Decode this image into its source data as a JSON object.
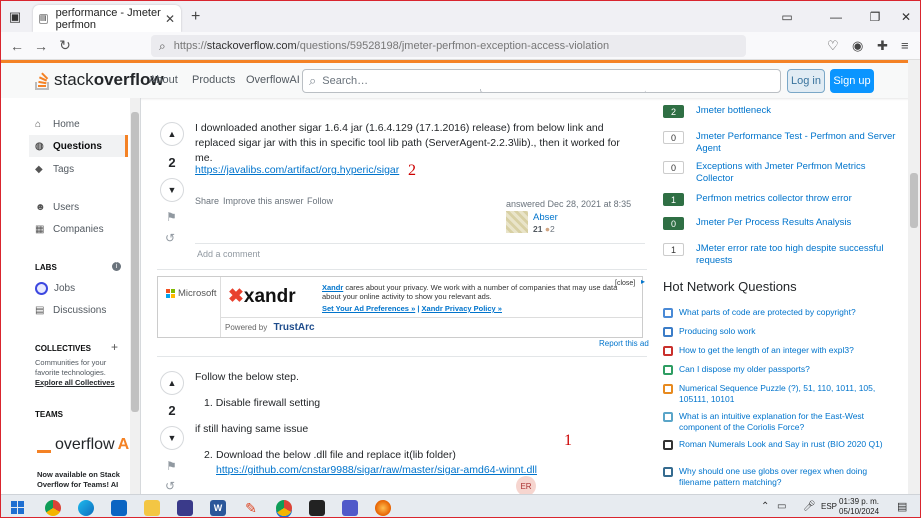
{
  "browser": {
    "tab_title": "performance - Jmeter perfmon",
    "url_prefix": "https://",
    "url_host": "stackoverflow.com",
    "url_path": "/questions/59528198/jmeter-perfmon-exception-access-violation"
  },
  "header": {
    "logo_text_light": "stack",
    "logo_text_bold": "overflow",
    "links": [
      "About",
      "Products",
      "OverflowAI"
    ],
    "search_placeholder": "Search…",
    "login_label": "Log in",
    "signup_label": "Sign up"
  },
  "leftnav": {
    "items": [
      {
        "label": "Home",
        "icon": "home-icon"
      },
      {
        "label": "Questions",
        "icon": "globe-icon"
      },
      {
        "label": "Tags",
        "icon": "tag-icon"
      },
      {
        "label": "Users",
        "icon": "users-icon"
      },
      {
        "label": "Companies",
        "icon": "building-icon"
      }
    ],
    "labs_heading": "LABS",
    "labs_items": [
      "Jobs",
      "Discussions"
    ],
    "collectives_heading": "COLLECTIVES",
    "collectives_text": "Communities for your favorite technologies.",
    "collectives_link": "Explore all Collectives",
    "teams_heading": "TEAMS",
    "teams_logo_text": "overflow",
    "teams_logo_ai": "AI",
    "teams_text": "Now available on Stack Overflow for Teams! AI"
  },
  "answer1": {
    "score": "2",
    "text": "I downloaded another sigar 1.6.4 jar (1.6.4.129 (17.1.2016) release) from below link and replaced sigar jar with this in specific tool lib path (ServerAgent-2.2.3\\lib)., then it worked for me.",
    "link": "https://javalibs.com/artifact/org.hyperic/sigar",
    "annotation": "2",
    "actions": [
      "Share",
      "Improve this answer",
      "Follow"
    ],
    "answered": "answered Dec 28, 2021 at 8:35",
    "user": "Abser",
    "rep": "21",
    "bronze": "2",
    "add_comment": "Add a comment"
  },
  "ad": {
    "microsoft": "Microsoft",
    "xandr": "xandr",
    "privacy_bold": "Xandr",
    "privacy_text": " cares about your privacy. We work with a number of companies that may use data about your online activity to show you relevant ads.",
    "prefs_link": "Set Your Ad Preferences »",
    "policy_link": "Xandr Privacy Policy »",
    "close": "[close]",
    "powered_by": "Powered by",
    "trustarc": "TrustArc",
    "report": "Report this ad"
  },
  "answer2": {
    "score": "2",
    "intro": "Follow the below step.",
    "step1": "Disable firewall setting",
    "middle": "if still having same issue",
    "step2_text": "Download the below .dll file and replace it(lib folder) ",
    "step2_link": "https://github.com/cnstar9988/sigar/raw/master/sigar-amd64-winnt.dll",
    "annotation": "1",
    "avatar": "ER"
  },
  "related": [
    {
      "count": "2",
      "answered": true,
      "title": "Jmeter bottleneck"
    },
    {
      "count": "0",
      "answered": false,
      "title": "Jmeter Performance Test - Perfmon and Server Agent"
    },
    {
      "count": "0",
      "answered": false,
      "title": "Exceptions with Jmeter Perfmon Metrics Collector"
    },
    {
      "count": "1",
      "answered": true,
      "title": "Perfmon metrics collector throw error"
    },
    {
      "count": "0",
      "answered": true,
      "title": "Jmeter Per Process Results Analysis"
    },
    {
      "count": "1",
      "answered": false,
      "title": "JMeter error rate too high despite successful requests"
    }
  ],
  "hot_heading": "Hot Network Questions",
  "hot": [
    {
      "title": "What parts of code are protected by copyright?",
      "color": "#4a8ad6"
    },
    {
      "title": "Producing solo work",
      "color": "#3b7cc7"
    },
    {
      "title": "How to get the length of an integer with expl3?",
      "color": "#c9302c"
    },
    {
      "title": "Can I dispose my older passports?",
      "color": "#2e9d62"
    },
    {
      "title": "Numerical Sequence Puzzle (?), 51, 110, 1011, 105, 105111, 10101",
      "color": "#e78a1f"
    },
    {
      "title": "What is an intuitive explanation for the East-West component of the Coriolis Force?",
      "color": "#5aa5c8"
    },
    {
      "title": "Roman Numerals Look and Say in rust (BIO 2020 Q1)",
      "color": "#333333"
    },
    {
      "title": "Why should one use globs over regex when doing filename pattern matching?",
      "color": "#356b8f"
    }
  ],
  "taskbar": {
    "lang": "ESP",
    "time": "01:39 p. m.",
    "date": "05/10/2024"
  },
  "colors": {
    "brand_orange": "#f48225",
    "link": "#0074cc",
    "accepted_green": "#2f6f44",
    "annotation_red": "#cc0000"
  }
}
